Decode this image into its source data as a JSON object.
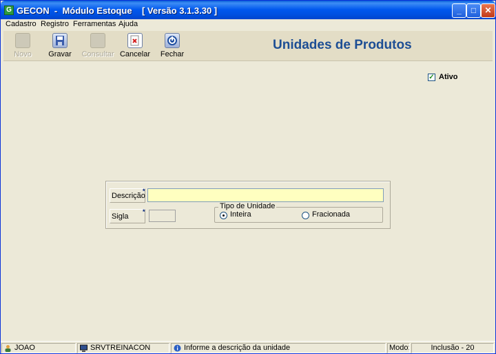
{
  "window": {
    "title": "GECON  -  Módulo Estoque    [ Versão 3.1.3.30 ]",
    "app_icon_letter": "G",
    "minimize": "_",
    "maximize": "□",
    "close": "✕"
  },
  "menu": {
    "items": [
      {
        "label": "Cadastro"
      },
      {
        "label": "Registro"
      },
      {
        "label": "Ferramentas"
      },
      {
        "label": "Ajuda"
      }
    ]
  },
  "toolbar": {
    "novo": {
      "label": "Novo",
      "icon": "new-icon",
      "enabled": false
    },
    "gravar": {
      "label": "Gravar",
      "icon": "save-icon",
      "enabled": true
    },
    "consultar": {
      "label": "Consultar",
      "icon": "search-icon",
      "enabled": false
    },
    "cancelar": {
      "label": "Cancelar",
      "icon": "cancel-icon",
      "enabled": true
    },
    "fechar": {
      "label": "Fechar",
      "icon": "close-icon",
      "enabled": true
    }
  },
  "form": {
    "title": "Unidades de Produtos",
    "ativo": {
      "label": "Ativo",
      "checked": true
    },
    "descricao": {
      "label": "Descrição",
      "required_mark": "*",
      "value": ""
    },
    "sigla": {
      "label": "Sigla",
      "required_mark": "*",
      "value": ""
    },
    "tipo_unidade": {
      "title": "Tipo de Unidade",
      "options": [
        {
          "label": "Inteira",
          "selected": true
        },
        {
          "label": "Fracionada",
          "selected": false
        }
      ]
    }
  },
  "status": {
    "user": "JOAO",
    "server": "SRVTREINACON",
    "hint": "Informe a descrição da unidade",
    "mode_label": "Modo:",
    "mode_value": "Inclusão - 20"
  },
  "colors": {
    "title_accent": "#1d4e94",
    "required_input_bg": "#ffffc0"
  }
}
